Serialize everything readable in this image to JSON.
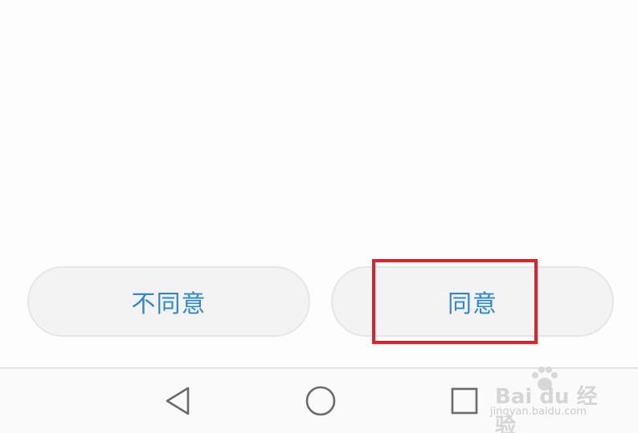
{
  "dialog": {
    "disagree_label": "不同意",
    "agree_label": "同意"
  },
  "nav": {
    "back_icon": "triangle-back-icon",
    "home_icon": "circle-home-icon",
    "recent_icon": "square-recent-icon"
  },
  "watermark": {
    "main": "Bai du 经验",
    "sub": "jingyan.baidu.com"
  },
  "colors": {
    "button_text": "#2f86d6",
    "highlight": "#e0202a",
    "background": "#fcfcfc"
  }
}
